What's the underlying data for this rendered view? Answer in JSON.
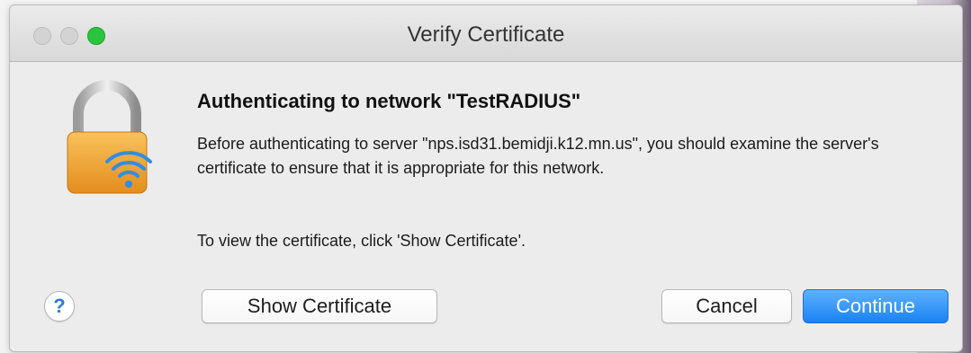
{
  "window": {
    "title": "Verify Certificate"
  },
  "dialog": {
    "icon": "wifi-lock-icon",
    "heading": "Authenticating to network \"TestRADIUS\"",
    "message": "Before authenticating to server \"nps.isd31.bemidji.k12.mn.us\", you should examine the server's certificate to ensure that it is appropriate for this network.",
    "instruction": "To view the certificate, click 'Show Certificate'."
  },
  "buttons": {
    "help": "?",
    "show_certificate": "Show Certificate",
    "cancel": "Cancel",
    "continue": "Continue"
  },
  "colors": {
    "accent": "#1a82f3",
    "lock_gold": "#f2a83a",
    "zoom_green": "#2bc43f"
  }
}
